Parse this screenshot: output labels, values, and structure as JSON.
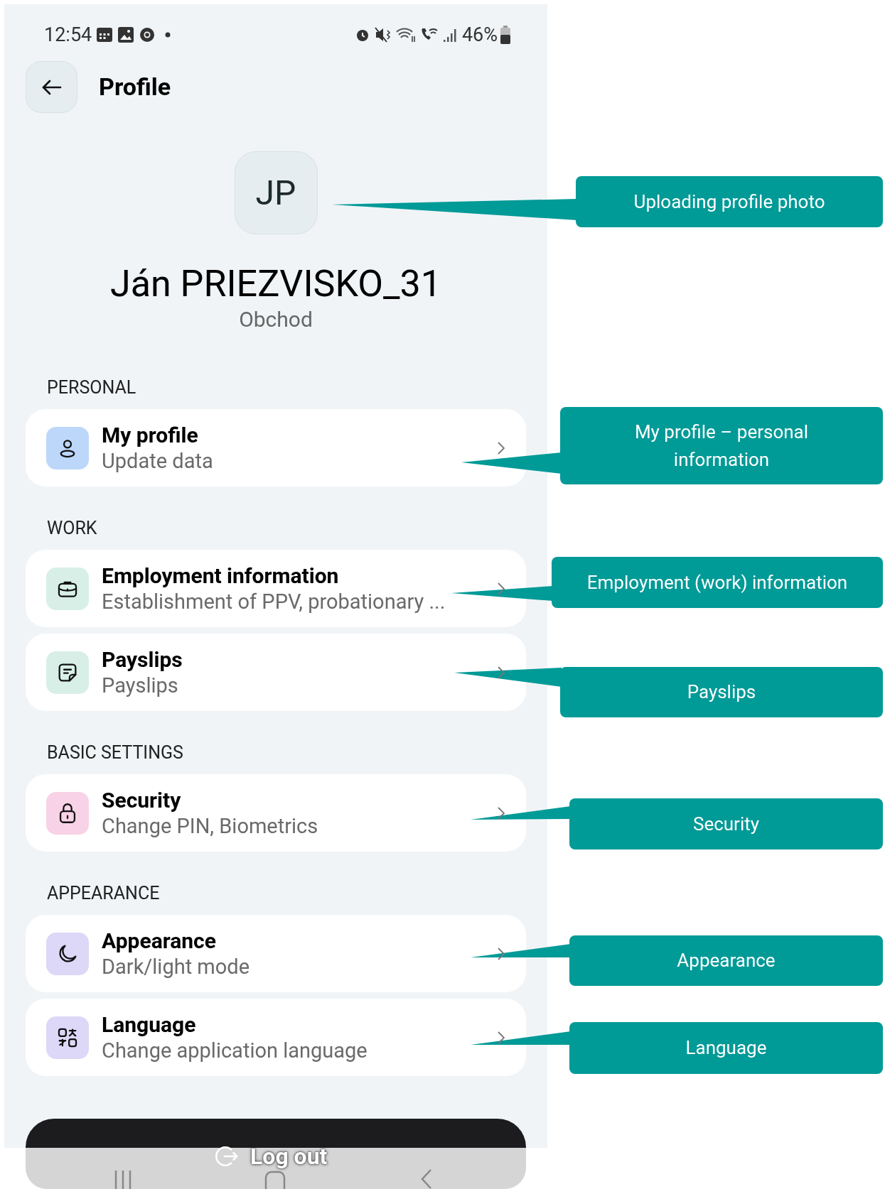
{
  "status_bar": {
    "time": "12:54",
    "battery": "46%"
  },
  "header": {
    "title": "Profile"
  },
  "profile": {
    "initials": "JP",
    "name": "Ján PRIEZVISKO_31",
    "department": "Obchod"
  },
  "sections": [
    {
      "title": "PERSONAL",
      "items": [
        {
          "kind": "person",
          "color": "#bcd7fa",
          "title": "My profile",
          "subtitle": "Update data"
        }
      ]
    },
    {
      "title": "WORK",
      "items": [
        {
          "kind": "briefcase",
          "color": "#d8efe8",
          "title": "Employment information",
          "subtitle": "Establishment of PPV, probationary ..."
        },
        {
          "kind": "note",
          "color": "#d8efe8",
          "title": "Payslips",
          "subtitle": "Payslips"
        }
      ]
    },
    {
      "title": "BASIC SETTINGS",
      "items": [
        {
          "kind": "lock",
          "color": "#f8d2e6",
          "title": "Security",
          "subtitle": "Change PIN, Biometrics"
        }
      ]
    },
    {
      "title": "APPEARANCE",
      "items": [
        {
          "kind": "moon",
          "color": "#ddd8f7",
          "title": "Appearance",
          "subtitle": "Dark/light mode"
        },
        {
          "kind": "language",
          "color": "#ddd8f7",
          "title": "Language",
          "subtitle": "Change application language"
        }
      ]
    }
  ],
  "logout_button": {
    "label": "Log out"
  },
  "annotations": [
    {
      "text": "Uploading profile photo"
    },
    {
      "text": "My profile – personal information"
    },
    {
      "text": "Employment (work) information"
    },
    {
      "text": "Payslips"
    },
    {
      "text": "Security"
    },
    {
      "text": "Appearance"
    },
    {
      "text": "Language"
    }
  ]
}
